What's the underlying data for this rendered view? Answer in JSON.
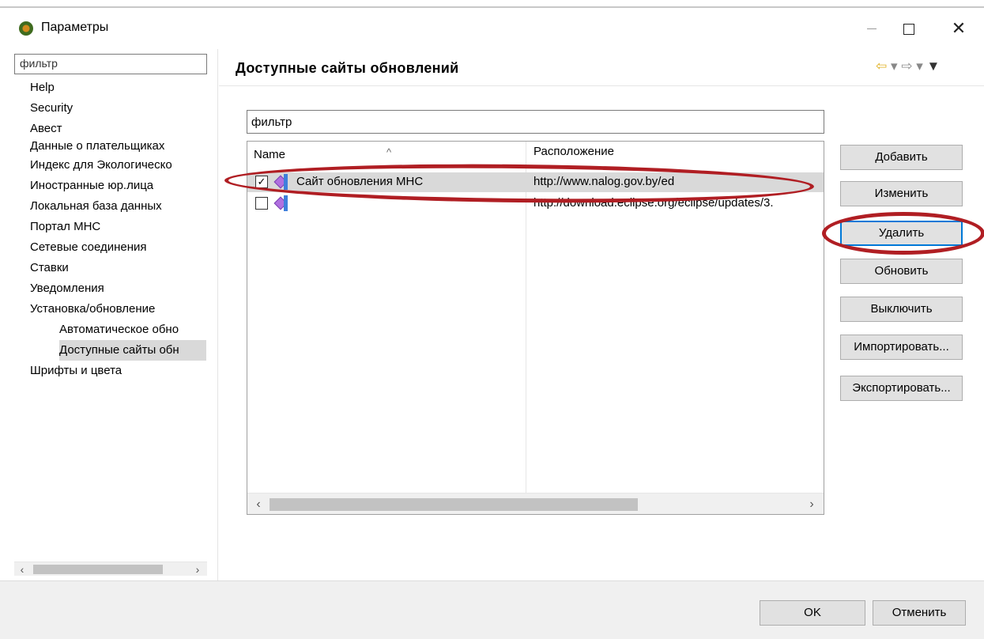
{
  "window": {
    "title": "Параметры"
  },
  "left_pane": {
    "filter_value": "фильтр",
    "tree": [
      {
        "label": "Help",
        "level": 0
      },
      {
        "label": "Security",
        "level": 0
      },
      {
        "label": "Авест",
        "level": 0
      },
      {
        "label": "Данные о плательщиках",
        "level": 0
      },
      {
        "label": "Индекс для Экологическо",
        "level": 0
      },
      {
        "label": "Иностранные юр.лица",
        "level": 0
      },
      {
        "label": "Локальная база данных",
        "level": 0
      },
      {
        "label": "Портал МНС",
        "level": 0
      },
      {
        "label": "Сетевые соединения",
        "level": 0
      },
      {
        "label": "Ставки",
        "level": 0
      },
      {
        "label": "Уведомления",
        "level": 0
      },
      {
        "label": "Установка/обновление",
        "level": 0
      },
      {
        "label": "Автоматическое обно",
        "level": 1
      },
      {
        "label": "Доступные сайты обн",
        "level": 1,
        "selected": true
      },
      {
        "label": "Шрифты и цвета",
        "level": 0
      }
    ]
  },
  "main": {
    "title": "Доступные сайты обновлений",
    "filter_value": "фильтр",
    "table": {
      "headers": {
        "name": "Name",
        "location": "Расположение"
      },
      "rows": [
        {
          "checked": true,
          "name": "Сайт обновления МНС",
          "location": "http://www.nalog.gov.by/ed",
          "selected": true
        },
        {
          "checked": false,
          "name": "",
          "location": "http://download.eclipse.org/eclipse/updates/3."
        }
      ]
    },
    "buttons": {
      "add": "Добавить",
      "edit": "Изменить",
      "remove": "Удалить",
      "refresh": "Обновить",
      "disable": "Выключить",
      "import": "Импортировать...",
      "export": "Экспортировать..."
    }
  },
  "footer": {
    "ok": "OK",
    "cancel": "Отменить"
  },
  "icons": {
    "back": "⇦",
    "forward": "⇨",
    "dropdown": "▾",
    "menu": "▼",
    "scroll_left": "‹",
    "scroll_right": "›",
    "sort_up": "^",
    "check": "✓",
    "close": "✕"
  },
  "colors": {
    "annotation": "#b01e23",
    "focus": "#0078d7",
    "selection": "#d9d9d9"
  }
}
